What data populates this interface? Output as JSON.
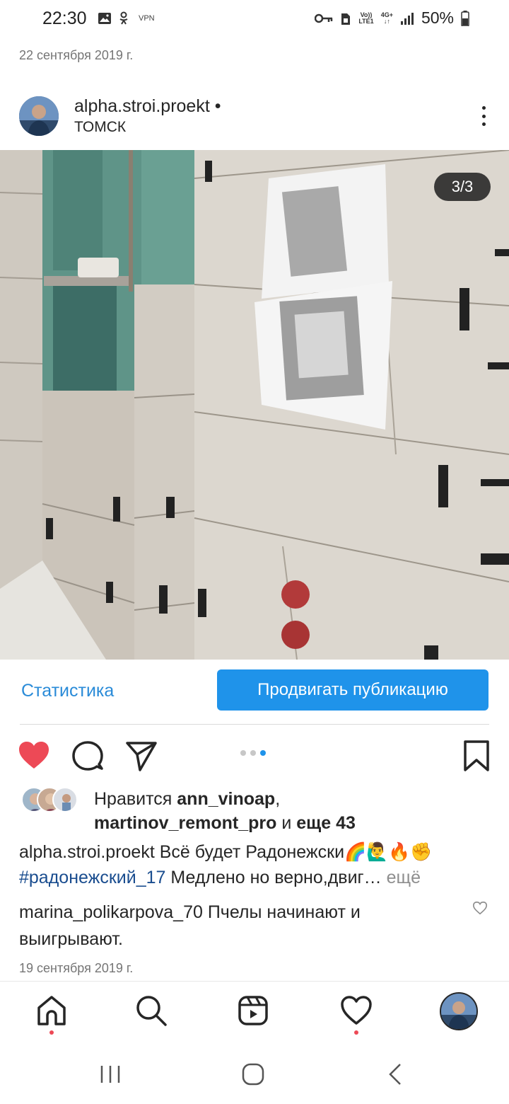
{
  "status_bar": {
    "time": "22:30",
    "vpn": "VPN",
    "volte": "Vo))",
    "lte": "LTE1",
    "network": "4G+",
    "battery": "50%"
  },
  "post": {
    "date_top": "22 сентября 2019 г.",
    "username": "alpha.stroi.proekt",
    "separator": "•",
    "location": "ТОМСК",
    "counter": "3/3"
  },
  "promo": {
    "stats_label": "Статистика",
    "promote_label": "Продвигать публикацию"
  },
  "likes": {
    "prefix": "Нравится ",
    "user1": "ann_vinoap",
    "comma": ",",
    "user2": "martinov_remont_pro",
    "and": " и ",
    "others": "еще 43"
  },
  "caption": {
    "username": "alpha.stroi.proekt",
    "text": " Всё будет Радонежски🌈🙋‍♂️🔥✊",
    "hashtag": "#радонежский_17",
    "text2": " Медлено но верно,двиг…",
    "more": " ещё"
  },
  "comment": {
    "username": "marina_polikarpova_70",
    "text": " Пчелы начинают и выигрывают."
  },
  "date_bottom": "19 сентября 2019 г.",
  "colors": {
    "accent": "#1f93ea",
    "like": "#ed4956",
    "hashtag": "#1a4d8f",
    "muted": "#757575"
  },
  "icons": {
    "like": "heart-filled-icon",
    "comment": "comment-bubble-icon",
    "share": "paper-plane-icon",
    "save": "bookmark-icon",
    "nav": [
      "home-icon",
      "search-icon",
      "reels-icon",
      "heart-icon",
      "profile-avatar"
    ],
    "system": [
      "recent-apps-icon",
      "home-circle-icon",
      "back-icon"
    ]
  }
}
